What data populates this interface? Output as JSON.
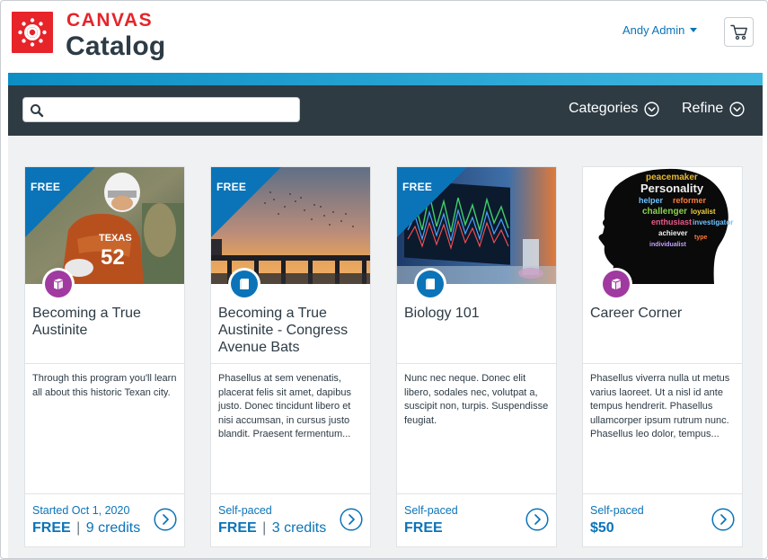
{
  "header": {
    "logo_top": "CANVAS",
    "logo_bottom": "Catalog",
    "user_name": "Andy Admin"
  },
  "nav": {
    "search_placeholder": "",
    "categories_label": "Categories",
    "refine_label": "Refine"
  },
  "colors": {
    "brand_red": "#e62429",
    "accent_blue": "#0b74b8",
    "navbar_bg": "#2e3b43",
    "program_purple": "#a03aa0"
  },
  "cards": [
    {
      "ribbon": "FREE",
      "badge_icon": "program-stack-icon",
      "title": "Becoming a True Austinite",
      "description": "Through this program you'll learn all about this historic Texan city.",
      "pace": "Started Oct 1, 2020",
      "price": "FREE",
      "credits": "9 credits"
    },
    {
      "ribbon": "FREE",
      "badge_icon": "course-book-icon",
      "title": "Becoming a True Austinite - Congress Avenue Bats",
      "description": "Phasellus at sem venenatis, placerat felis sit amet, dapibus justo. Donec tincidunt libero et nisi accumsan, in cursus justo blandit. Praesent fermentum...",
      "pace": "Self-paced",
      "price": "FREE",
      "credits": "3 credits"
    },
    {
      "ribbon": "FREE",
      "badge_icon": "course-book-icon",
      "title": "Biology 101",
      "description": "Nunc nec neque. Donec elit libero, sodales nec, volutpat a, suscipit non, turpis. Suspendisse feugiat.",
      "pace": "Self-paced",
      "price": "FREE",
      "credits": ""
    },
    {
      "ribbon": "",
      "badge_icon": "program-stack-icon",
      "title": "Career Corner",
      "description": "Phasellus viverra nulla ut metus varius laoreet. Ut a nisl id ante tempus hendrerit. Phasellus ullamcorper ipsum rutrum nunc. Phasellus leo dolor, tempus...",
      "pace": "Self-paced",
      "price": "$50",
      "credits": ""
    }
  ]
}
